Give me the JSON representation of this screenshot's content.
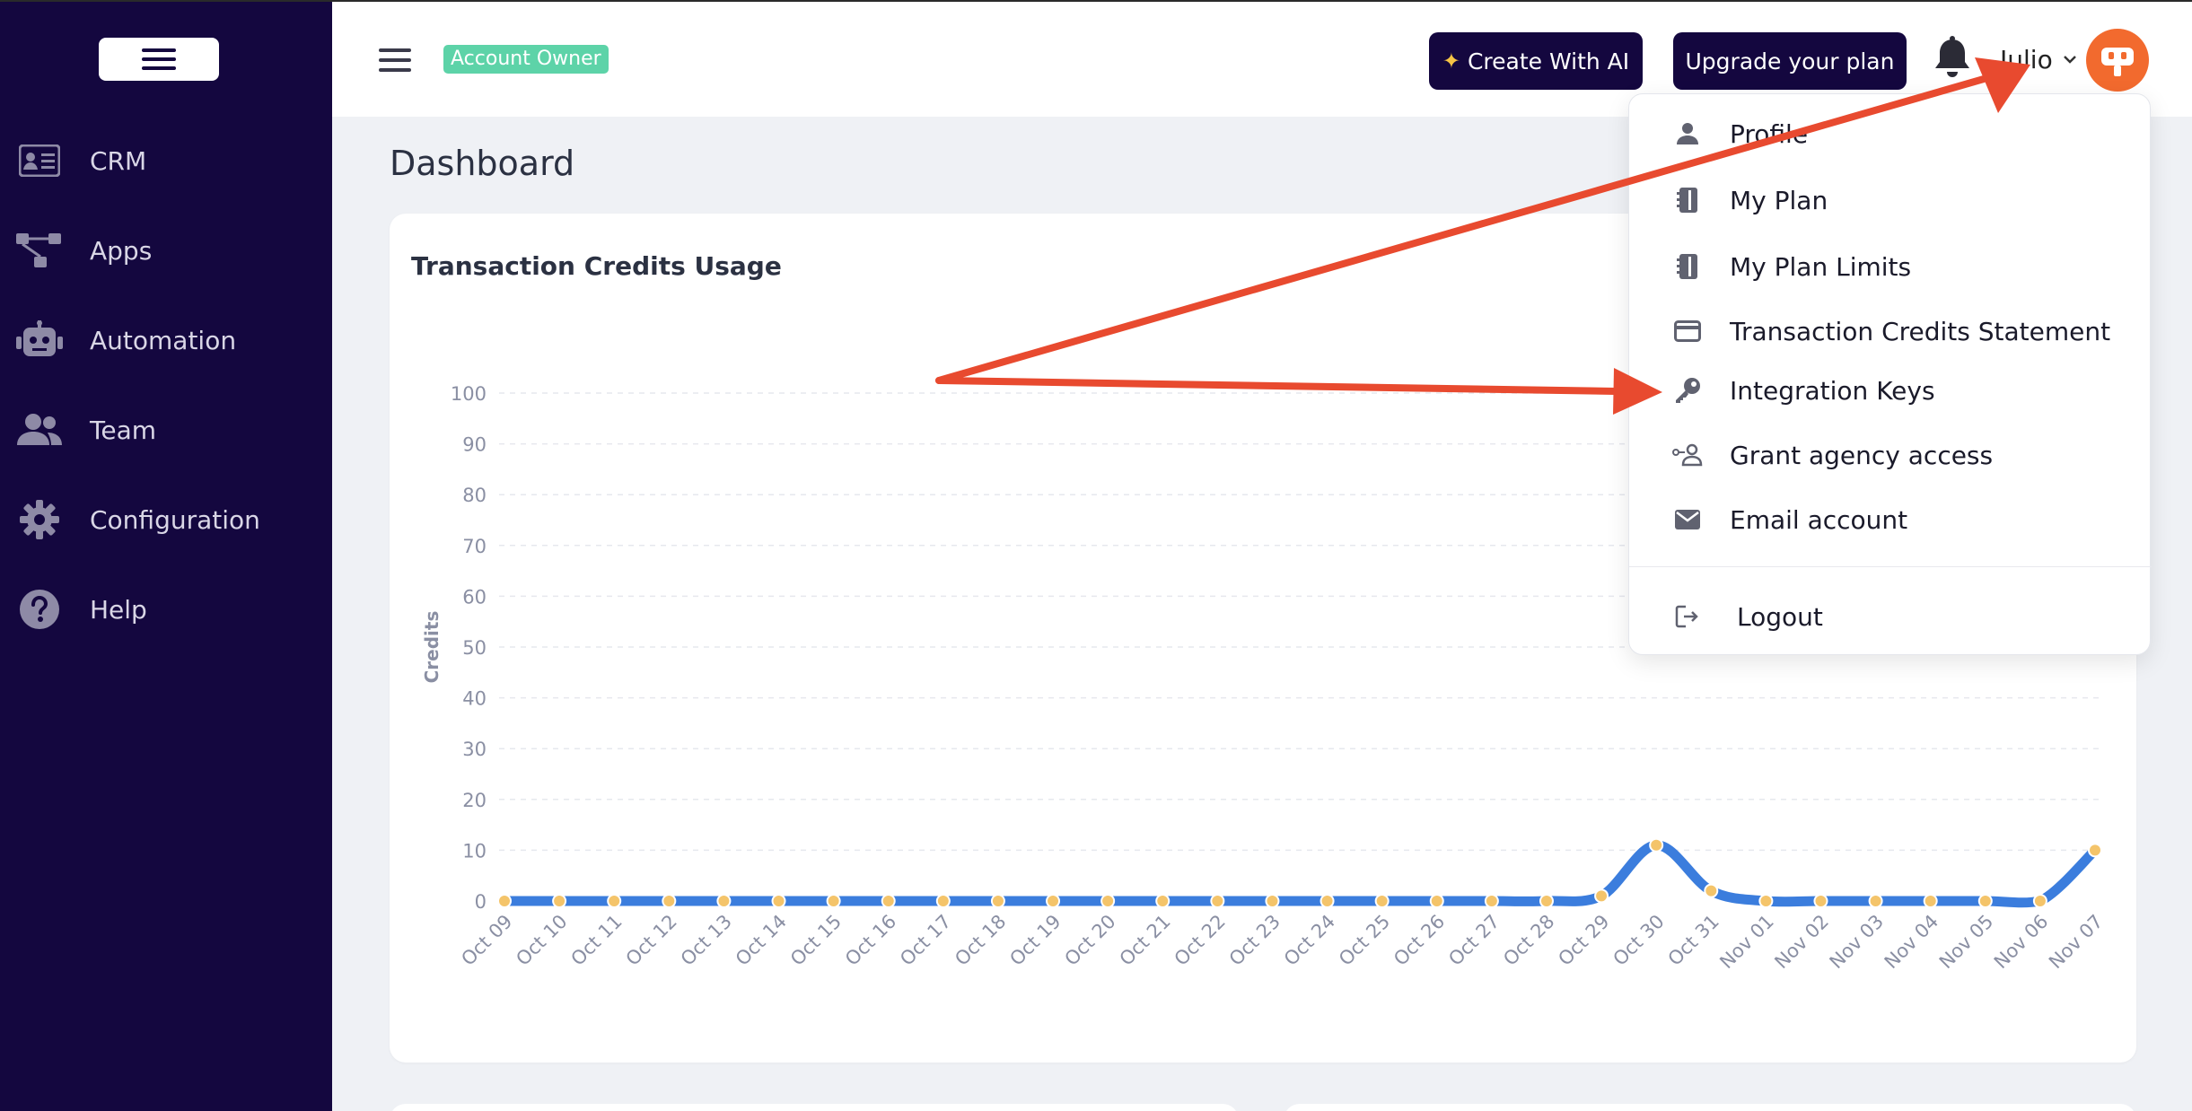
{
  "sidebar": {
    "items": [
      {
        "label": "CRM",
        "icon": "id-card-icon"
      },
      {
        "label": "Apps",
        "icon": "apps-network-icon"
      },
      {
        "label": "Automation",
        "icon": "robot-icon"
      },
      {
        "label": "Team",
        "icon": "team-icon"
      },
      {
        "label": "Configuration",
        "icon": "gear-icon"
      },
      {
        "label": "Help",
        "icon": "help-icon"
      }
    ]
  },
  "header": {
    "badge": "Account Owner",
    "create_ai": "Create With AI",
    "upgrade": "Upgrade your plan",
    "user": "Julio"
  },
  "main": {
    "title": "Dashboard"
  },
  "dropdown": {
    "items": [
      {
        "label": "Profile",
        "icon": "user-icon"
      },
      {
        "label": "My Plan",
        "icon": "notebook-icon"
      },
      {
        "label": "My Plan Limits",
        "icon": "notebook-icon"
      },
      {
        "label": "Transaction Credits Statement",
        "icon": "credit-card-icon"
      },
      {
        "label": "Integration Keys",
        "icon": "key-icon"
      },
      {
        "label": "Grant agency access",
        "icon": "grant-access-icon"
      },
      {
        "label": "Email account",
        "icon": "envelope-icon"
      }
    ],
    "logout": "Logout"
  },
  "colors": {
    "sidebar_bg": "#14073f",
    "accent_badge": "#5dd3a8",
    "avatar": "#f26a2e",
    "line": "#3b7ddd",
    "point": "#f4c46a",
    "arrow": "#e84a2f"
  },
  "chart_data": {
    "type": "line",
    "title": "Transaction Credits Usage",
    "xlabel": "",
    "ylabel": "Credits",
    "ylim": [
      0,
      100
    ],
    "yticks": [
      0,
      10,
      20,
      30,
      40,
      50,
      60,
      70,
      80,
      90,
      100
    ],
    "grid": true,
    "categories": [
      "Oct 09",
      "Oct 10",
      "Oct 11",
      "Oct 12",
      "Oct 13",
      "Oct 14",
      "Oct 15",
      "Oct 16",
      "Oct 17",
      "Oct 18",
      "Oct 19",
      "Oct 20",
      "Oct 21",
      "Oct 22",
      "Oct 23",
      "Oct 24",
      "Oct 25",
      "Oct 26",
      "Oct 27",
      "Oct 28",
      "Oct 29",
      "Oct 30",
      "Oct 31",
      "Nov 01",
      "Nov 02",
      "Nov 03",
      "Nov 04",
      "Nov 05",
      "Nov 06",
      "Nov 07"
    ],
    "values": [
      0,
      0,
      0,
      0,
      0,
      0,
      0,
      0,
      0,
      0,
      0,
      0,
      0,
      0,
      0,
      0,
      0,
      0,
      0,
      0,
      1,
      11,
      2,
      0,
      0,
      0,
      0,
      0,
      0,
      10
    ]
  }
}
